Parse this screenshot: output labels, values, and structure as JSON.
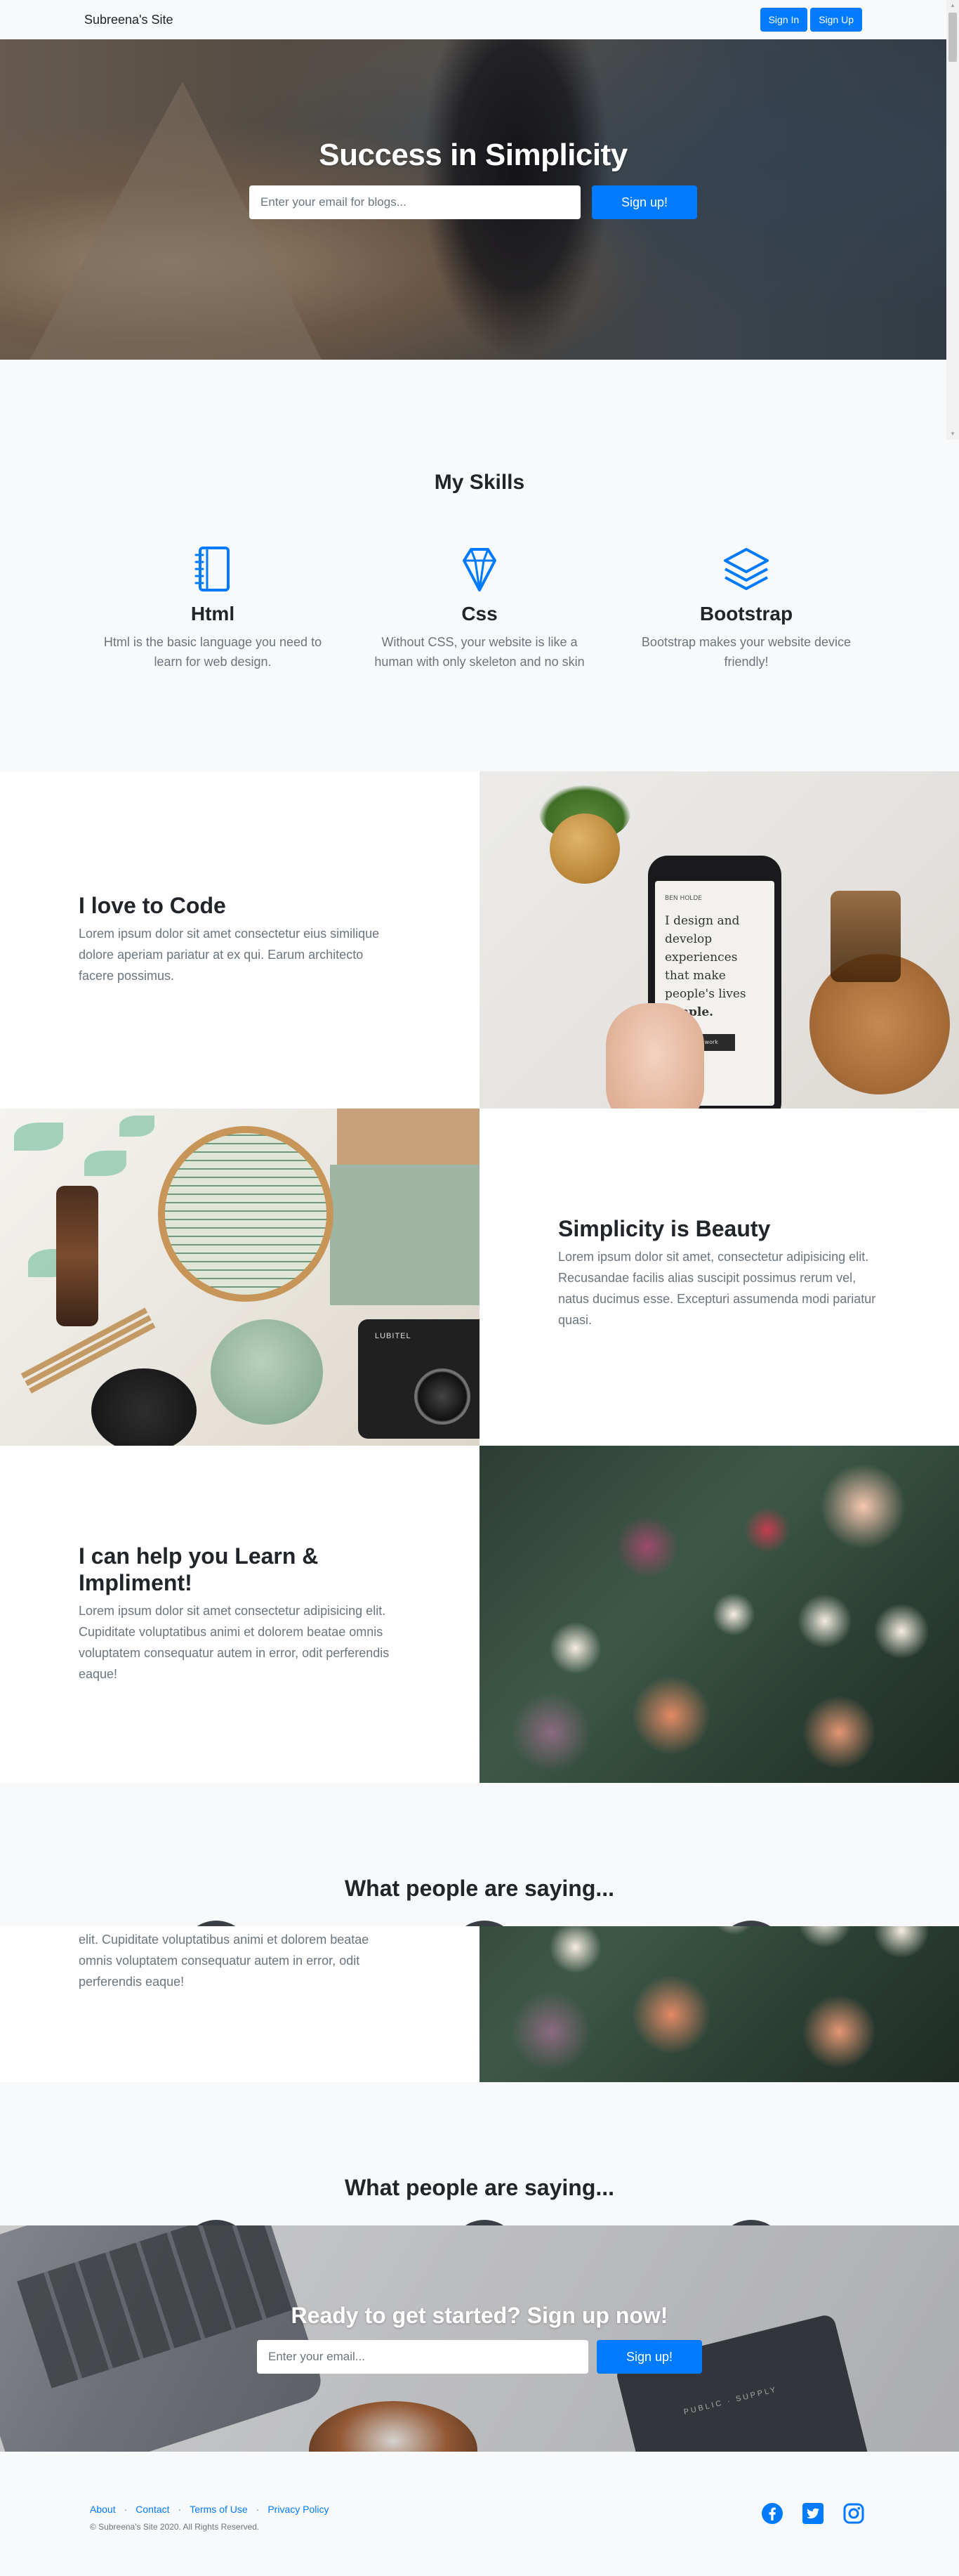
{
  "navbar": {
    "brand": "Subreena's Site",
    "sign_in": "Sign In",
    "sign_up": "Sign Up"
  },
  "hero": {
    "title": "Success in Simplicity",
    "email_placeholder": "Enter your email for blogs...",
    "submit": "Sign up!"
  },
  "skills": {
    "title": "My Skills",
    "items": [
      {
        "icon": "notebook-icon",
        "name": "Html",
        "description": "Html is the basic language you need to learn for web design."
      },
      {
        "icon": "diamond-icon",
        "name": "Css",
        "description": "Without CSS, your website is like a human with only skeleton and no skin"
      },
      {
        "icon": "layers-icon",
        "name": "Bootstrap",
        "description": "Bootstrap makes your website device friendly!"
      }
    ]
  },
  "showcase": [
    {
      "title": "I love to Code",
      "body": "Lorem ipsum dolor sit amet consectetur eius similique dolore aperiam pariatur at ex qui. Earum architecto facere possimus."
    },
    {
      "title": "Simplicity is Beauty",
      "body": "Lorem ipsum dolor sit amet, consectetur adipisicing elit. Recusandae facilis alias suscipit possimus rerum vel, natus ducimus esse. Excepturi assumenda modi pariatur quasi."
    },
    {
      "title": "I can help you Learn & Impliment!",
      "body": "Lorem ipsum dolor sit amet consectetur adipisicing elit. Cupiditate voluptatibus animi et dolorem beatae omnis voluptatem consequatur autem in error, odit perferendis eaque!"
    }
  ],
  "phone_screen": {
    "brand": "BEN HOLDE",
    "lines": [
      "I design and",
      "develop",
      "experiences",
      "that make",
      "people's lives"
    ],
    "emphasis": "simple.",
    "button": "See my work"
  },
  "testimonials": {
    "title": "What people are saying..."
  },
  "strip": {
    "body": "elit. Cupiditate voluptatibus animi et dolorem beatae omnis voluptatem consequatur autem in error, odit perferendis eaque!"
  },
  "cta": {
    "title": "Ready to get started? Sign up now!",
    "email_placeholder": "Enter your email...",
    "submit": "Sign up!"
  },
  "notebook_text": "PUBLIC · SUPPLY",
  "camera_brand": "LUBITEL",
  "footer": {
    "links": [
      "About",
      "Contact",
      "Terms of Use",
      "Privacy Policy"
    ],
    "copyright": "© Subreena's Site 2020. All Rights Reserved.",
    "social_icons": [
      "facebook-icon",
      "twitter-icon",
      "instagram-icon"
    ]
  },
  "colors": {
    "primary": "#007bff",
    "background": "#f8f9fa",
    "text": "#212529",
    "muted": "#6c757d"
  }
}
